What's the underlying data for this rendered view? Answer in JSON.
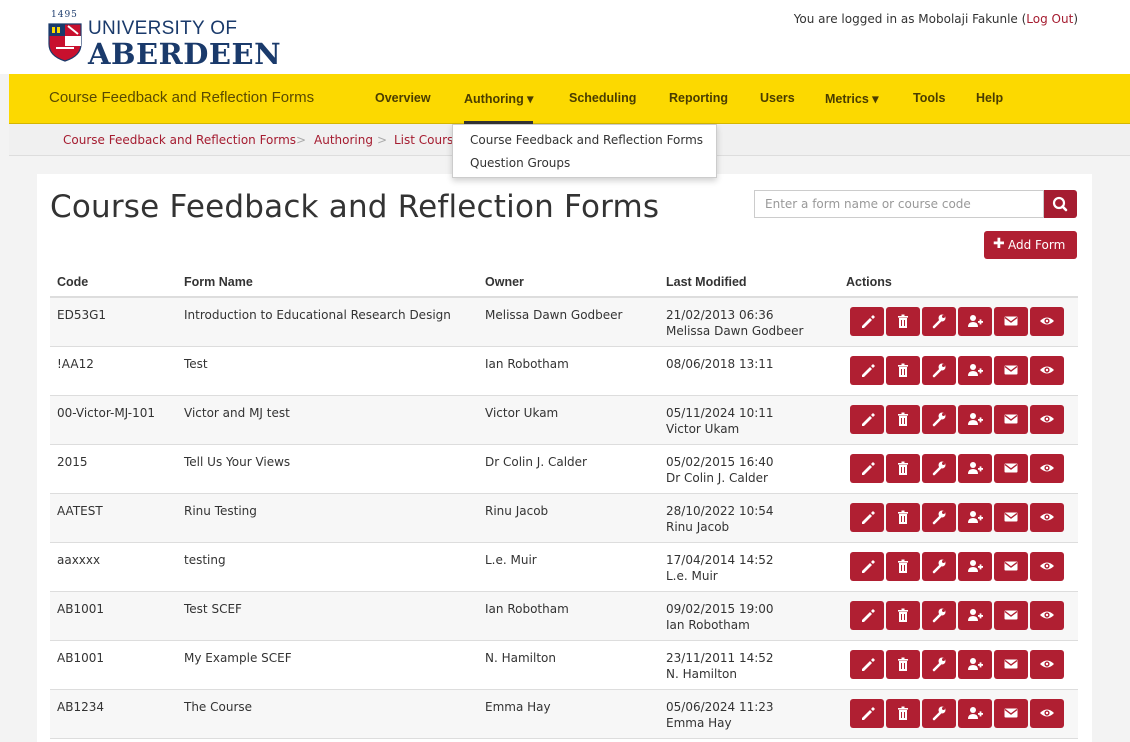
{
  "header": {
    "logo_year": "1495",
    "logo_line1": "UNIVERSITY OF",
    "logo_line2": "ABERDEEN",
    "login_text": "You are logged in as Mobolaji Fakunle (",
    "logout_label": "Log Out",
    "login_close": ")"
  },
  "nav": {
    "brand": "Course Feedback and Reflection Forms",
    "items": [
      "Overview",
      "Authoring ▾",
      "Scheduling",
      "Reporting",
      "Users",
      "Metrics ▾",
      "Tools",
      "Help"
    ]
  },
  "breadcrumb": {
    "items": [
      "Course Feedback and Reflection Forms",
      "Authoring",
      "List Cours"
    ],
    "separator": ">"
  },
  "dropdown": {
    "items": [
      "Course Feedback and Reflection Forms",
      "Question Groups"
    ]
  },
  "main": {
    "title": "Course Feedback and Reflection Forms",
    "search_placeholder": "Enter a form name or course code",
    "add_label": "Add Form"
  },
  "table": {
    "headers": [
      "Code",
      "Form Name",
      "Owner",
      "Last Modified",
      "Actions"
    ],
    "rows": [
      {
        "code": "ED53G1",
        "name": "Introduction to Educational Research Design",
        "owner": "Melissa Dawn Godbeer",
        "date": "21/02/2013 06:36",
        "by": "Melissa Dawn Godbeer"
      },
      {
        "code": "!AA12",
        "name": "Test",
        "owner": "Ian Robotham",
        "date": "08/06/2018 13:11",
        "by": ""
      },
      {
        "code": "00-Victor-MJ-101",
        "name": "Victor and MJ test",
        "owner": "Victor Ukam",
        "date": "05/11/2024 10:11",
        "by": "Victor Ukam"
      },
      {
        "code": "2015",
        "name": "Tell Us Your Views",
        "owner": "Dr Colin J. Calder",
        "date": "05/02/2015 16:40",
        "by": "Dr Colin J. Calder"
      },
      {
        "code": "AATEST",
        "name": "Rinu Testing",
        "owner": "Rinu Jacob",
        "date": "28/10/2022 10:54",
        "by": "Rinu Jacob"
      },
      {
        "code": "aaxxxx",
        "name": "testing",
        "owner": "L.e. Muir",
        "date": "17/04/2014 14:52",
        "by": "L.e. Muir"
      },
      {
        "code": "AB1001",
        "name": "Test SCEF",
        "owner": "Ian Robotham",
        "date": "09/02/2015 19:00",
        "by": "Ian Robotham"
      },
      {
        "code": "AB1001",
        "name": "My Example SCEF",
        "owner": "N. Hamilton",
        "date": "23/11/2011 14:52",
        "by": "N. Hamilton"
      },
      {
        "code": "AB1234",
        "name": "The Course",
        "owner": "Emma Hay",
        "date": "05/06/2024 11:23",
        "by": "Emma Hay"
      }
    ],
    "action_icons": [
      "edit-icon",
      "delete-icon",
      "settings-wrench-icon",
      "add-user-icon",
      "email-icon",
      "view-icon"
    ]
  },
  "colors": {
    "accent": "#b01f32",
    "navbar": "#fcd900",
    "brand_blue": "#1a3a6b"
  }
}
